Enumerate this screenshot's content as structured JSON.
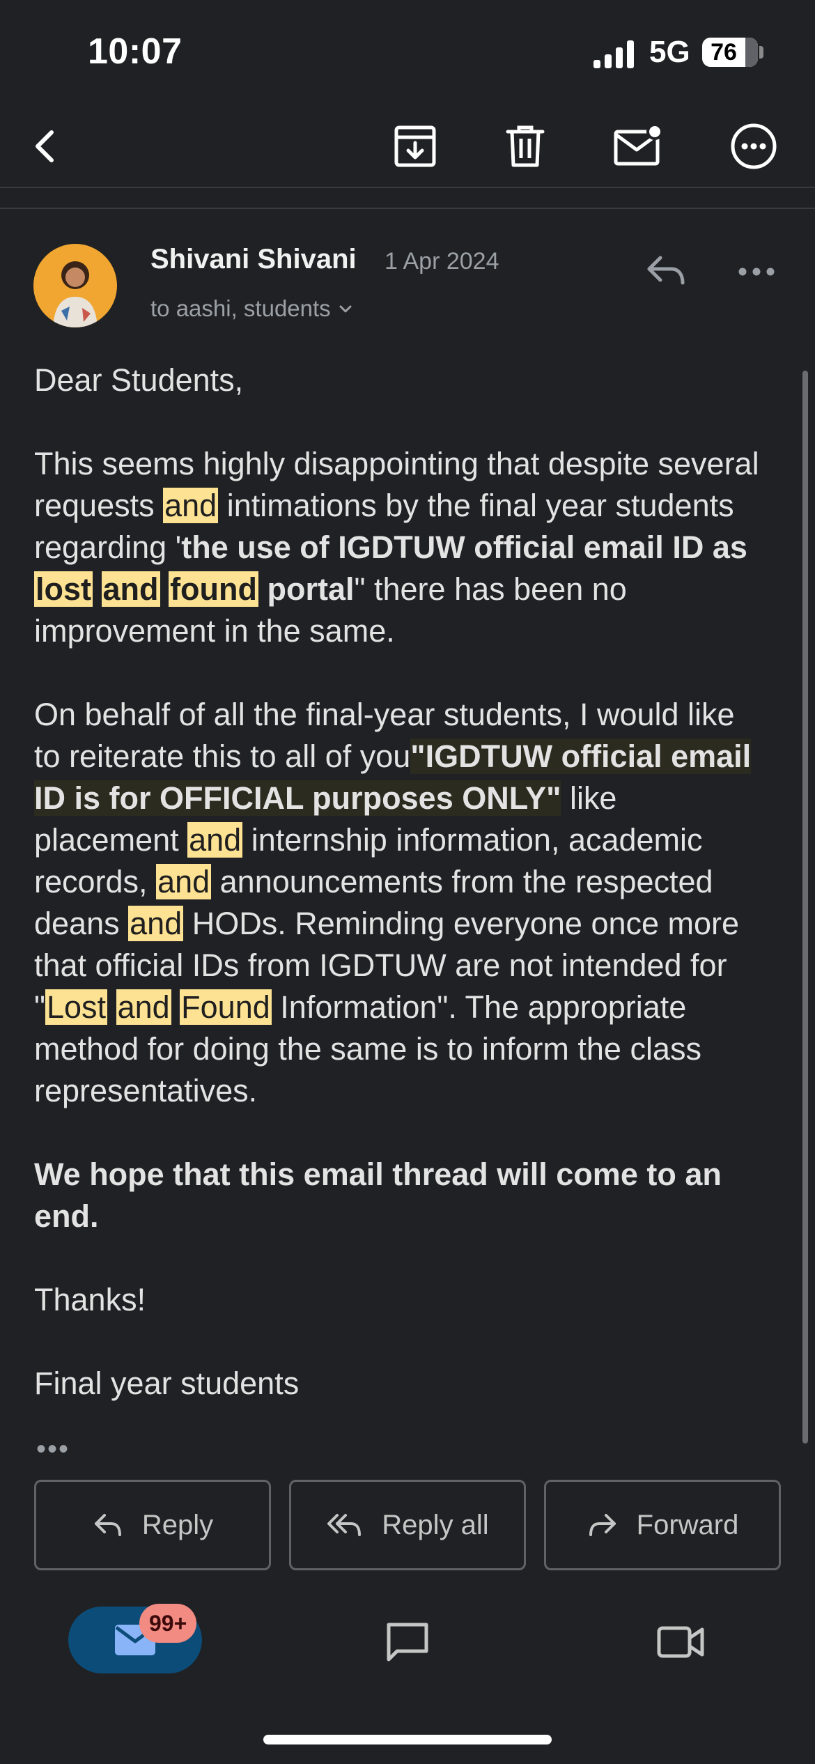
{
  "status_bar": {
    "time": "10:07",
    "network": "5G",
    "battery": "76"
  },
  "toolbar": {
    "icons": [
      "back-arrow-icon",
      "archive-icon",
      "trash-icon",
      "mark-unread-icon",
      "more-circle-icon"
    ]
  },
  "email": {
    "sender_name": "Shivani Shivani",
    "date": "1 Apr 2024",
    "recipients": "to aashi, students",
    "greeting": "Dear Students,",
    "para1": {
      "t1": "This seems highly disappointing that despite several requests ",
      "h1": "and",
      "t2": " intimations by the final year students regarding '",
      "b1": "the use of IGDTUW official email ID as ",
      "h2": "lost",
      "h3": "and",
      "h4": "found",
      "b2": " portal",
      "t3": "\" there has been no improvement in the same."
    },
    "para2": {
      "t1": "On behalf of all the final-year students, I would like to reiterate this to all of you",
      "b1": "\"IGDTUW official email ID is for OFFICIAL purposes ONLY\"",
      "t2": " like placement ",
      "h1": "and",
      "t3": " internship information, academic records, ",
      "h2": "and",
      "t4": " announcements from the respected deans ",
      "h3": "and",
      "t5": " HODs. Reminding everyone once more that official IDs from IGDTUW are not intended for \"",
      "h4": "Lost",
      "h5": "and",
      "h6": "Found",
      "t6": " Information\". The appropriate method for doing the same is to inform the class representatives."
    },
    "closing_bold": "We hope that this email thread will come to an end.",
    "thanks": "Thanks!",
    "signature": "Final year students",
    "ellipsis": "•••"
  },
  "actions": {
    "reply": "Reply",
    "reply_all": "Reply all",
    "forward": "Forward"
  },
  "bottom_nav": {
    "mail_badge": "99+",
    "tabs": [
      "mail-icon",
      "chat-icon",
      "video-camera-icon"
    ]
  },
  "colors": {
    "background": "#202124",
    "highlight": "#fde293",
    "nav_active": "#0b4c78",
    "badge": "#f28b82"
  }
}
